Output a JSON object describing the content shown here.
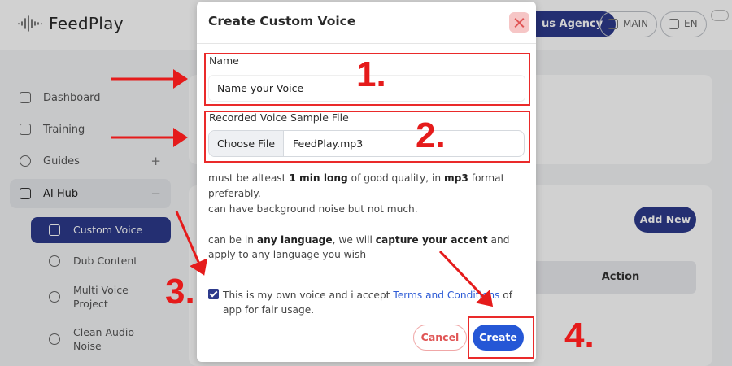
{
  "app": {
    "name": "FeedPlay"
  },
  "header": {
    "agency_label": "us Agency",
    "main_label": "MAIN",
    "lang_label": "EN"
  },
  "sidebar": {
    "items": [
      {
        "label": "Dashboard",
        "icon": "grid-icon"
      },
      {
        "label": "Training",
        "icon": "book-icon"
      },
      {
        "label": "Guides",
        "icon": "play-circle-icon",
        "expand": "+"
      },
      {
        "label": "AI Hub",
        "icon": "magic-wand-icon",
        "expand": "−"
      }
    ],
    "subitems": [
      {
        "label": "Custom Voice",
        "icon": "microphone-icon",
        "active": true
      },
      {
        "label": "Dub Content",
        "icon": "speaker-person-icon"
      },
      {
        "label": "Multi Voice Project",
        "icon": "users-icon"
      },
      {
        "label": "Clean Audio Noise",
        "icon": "music-note-icon"
      }
    ]
  },
  "main": {
    "add_new_label": "Add New",
    "table_header_action": "Action"
  },
  "modal": {
    "title": "Create Custom Voice",
    "name_label": "Name",
    "name_value": "Name your Voice",
    "file_label": "Recorded Voice Sample File",
    "choose_file_label": "Choose File",
    "file_name": "FeedPlay.mp3",
    "help": {
      "l1a": "must be alteast ",
      "l1b": "1 min long",
      "l1c": " of good quality, in ",
      "l1d": "mp3",
      "l1e": " format",
      "l2": "preferably.",
      "l3": "can have background noise but not much.",
      "l4a": "can be in ",
      "l4b": "any language",
      "l4c": ", we will ",
      "l4d": "capture your accent",
      "l4e": " and",
      "l5": "apply to any language you wish"
    },
    "consent_text": "This is my own voice and i accept ",
    "terms_link": "Terms and Conditions",
    "consent_suffix": " of app for fair usage.",
    "consent_checked": true,
    "cancel_label": "Cancel",
    "create_label": "Create"
  },
  "annotations": {
    "steps": [
      "1.",
      "2.",
      "3.",
      "4."
    ],
    "color": "#e51b1b"
  },
  "colors": {
    "primary": "#2d3a8c",
    "create_button": "#2557d6",
    "cancel": "#e05555"
  }
}
